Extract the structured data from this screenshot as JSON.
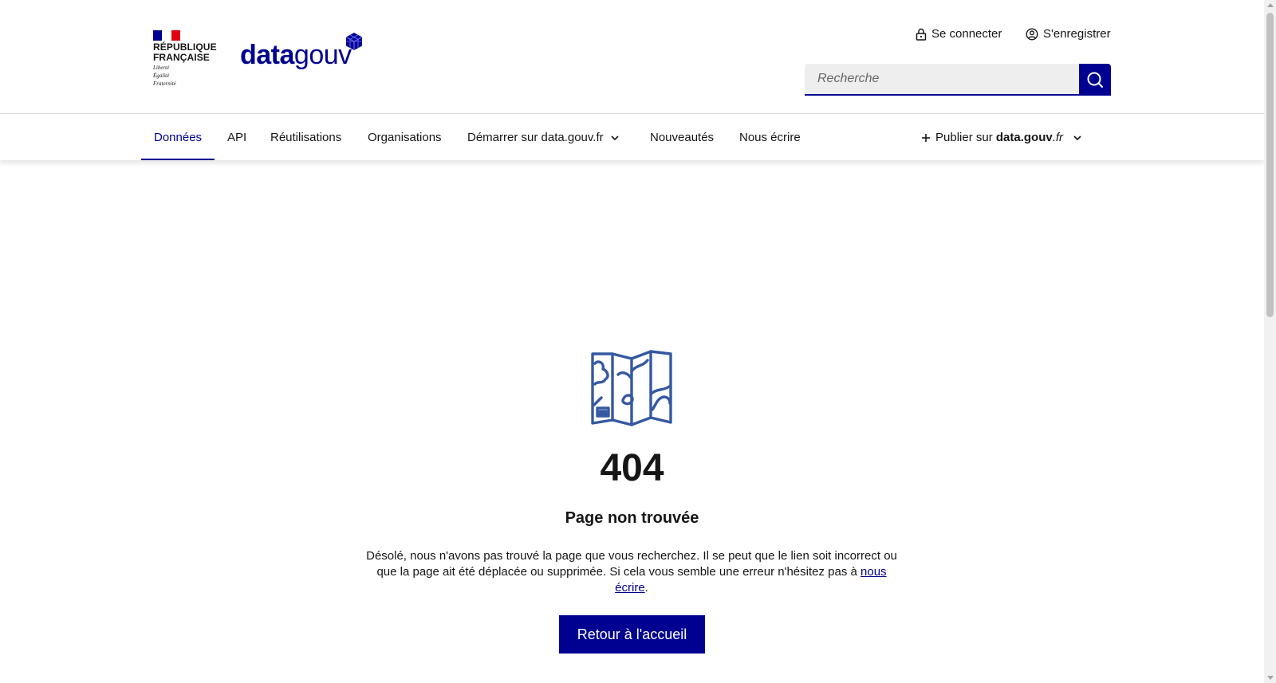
{
  "header": {
    "republique": [
      "RÉPUBLIQUE",
      "FRANÇAISE"
    ],
    "motto": [
      "Liberté",
      "Égalité",
      "Fraternité"
    ],
    "brand_bold": "data",
    "brand_light": "gouv",
    "login_label": "Se connecter",
    "register_label": "S'enregistrer",
    "search_placeholder": "Recherche"
  },
  "nav": {
    "items": [
      {
        "label": "Données",
        "active": true
      },
      {
        "label": "API"
      },
      {
        "label": "Réutilisations"
      },
      {
        "label": "Organisations"
      },
      {
        "label": "Démarrer sur data.gouv.fr",
        "dropdown": true
      },
      {
        "label": "Nouveautés"
      },
      {
        "label": "Nous écrire"
      }
    ],
    "publish": {
      "prefix": "Publier sur",
      "domain": "data.gouv",
      "tld": ".fr"
    }
  },
  "error": {
    "code": "404",
    "title": "Page non trouvée",
    "description": "Désolé, nous n'avons pas trouvé la page que vous recherchez. Il se peut que le lien soit incorrect ou que la page ait été déplacée ou supprimée. Si cela vous semble une erreur n'hésitez pas à",
    "link_label": "nous écrire",
    "end_punct": ".",
    "button_label": "Retour à l'accueil"
  },
  "colors": {
    "primary": "#000091",
    "flag_blue": "#000091",
    "flag_red": "#e1000f",
    "illustration": "#3558a2"
  },
  "icons": [
    "lock-icon",
    "user-circle-icon",
    "search-icon",
    "chevron-down-icon",
    "plus-icon",
    "map-icon",
    "cube-logo-icon"
  ]
}
